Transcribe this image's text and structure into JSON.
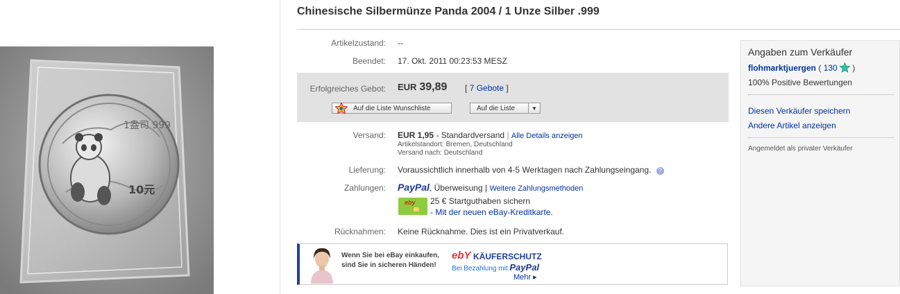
{
  "title": "Chinesische Silbermünze Panda 2004 / 1 Unze Silber .999",
  "details": {
    "condition_label": "Artikelzustand:",
    "condition_value": "--",
    "ended_label": "Beendet:",
    "ended_value": "17. Okt. 2011 00:23:53 MESZ"
  },
  "bid": {
    "label": "Erfolgreiches Gebot:",
    "currency": "EUR",
    "amount": "39,89",
    "bids_open": "[",
    "bids_link": "7 Gebote",
    "bids_close": "]",
    "watchlist_button": "Auf die Liste Wunschliste",
    "list_button": "Auf die Liste"
  },
  "shipping": {
    "label": "Versand:",
    "price": "EUR 1,95",
    "method": " - Standardversand",
    "separator": "|",
    "details_link": "Alle Details anzeigen",
    "location": "Artikelstandort: Bremen, Deutschland",
    "ships_to": "Versand nach: Deutschland"
  },
  "delivery": {
    "label": "Lieferung:",
    "value": "Voraussichtlich innerhalb von 4-5 Werktagen nach Zahlungseingang."
  },
  "payment": {
    "label": "Zahlungen:",
    "paypal": "PayPal",
    "rest": ", Überweisung |",
    "more_link": "Weitere Zahlungsmethoden",
    "credit_text": "25 € Startguthaben sichern",
    "credit_link": "- Mit der neuen eBay-Kreditkarte."
  },
  "returns": {
    "label": "Rücknahmen:",
    "value": "Keine Rücknahme. Dies ist ein Privatverkauf."
  },
  "ad": {
    "line1": "Wenn Sie bei eBay einkaufen,",
    "line2": "sind Sie in sicheren Händen!",
    "logo": "ebY",
    "protection": "KÄUFERSCHUTZ",
    "paypal_prefix": "Bei Bezahlung mit",
    "paypal": "PayPal",
    "more": "Mehr ▸"
  },
  "seller": {
    "heading": "Angaben zum Verkäufer",
    "name": "flohmarktjuergen",
    "score_open": "(",
    "score": "130",
    "score_close": ")",
    "positive": "100% Positive Bewertungen",
    "save_link": "Diesen Verkäufer speichern",
    "other_link": "Andere Artikel anzeigen",
    "registered": "Angemeldet als privater Verkäufer"
  },
  "coin": {
    "inscription": "1盎司 999",
    "value": "10元"
  },
  "icons": {
    "help": "help-icon",
    "star": "star-icon",
    "dropdown": "chevron-down-icon"
  }
}
